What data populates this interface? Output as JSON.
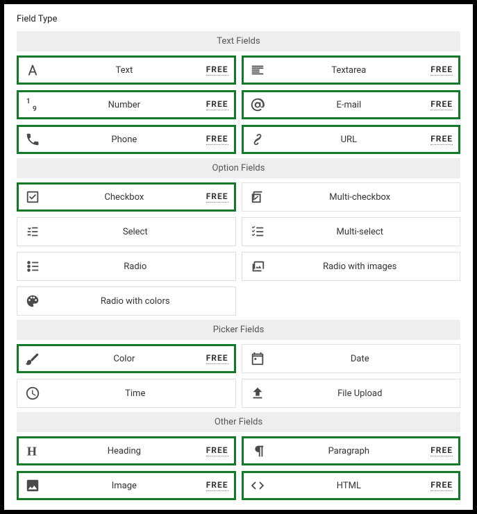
{
  "title": "Field Type",
  "free_label": "FREE",
  "sections": [
    {
      "id": "text-fields",
      "header": "Text Fields",
      "items": [
        {
          "id": "text",
          "label": "Text",
          "icon": "font-icon",
          "selected": true,
          "free": true
        },
        {
          "id": "textarea",
          "label": "Textarea",
          "icon": "align-left-icon",
          "selected": true,
          "free": true
        },
        {
          "id": "number",
          "label": "Number",
          "icon": "number-icon",
          "selected": true,
          "free": true
        },
        {
          "id": "email",
          "label": "E-mail",
          "icon": "at-icon",
          "selected": true,
          "free": true
        },
        {
          "id": "phone",
          "label": "Phone",
          "icon": "phone-icon",
          "selected": true,
          "free": true
        },
        {
          "id": "url",
          "label": "URL",
          "icon": "link-icon",
          "selected": true,
          "free": true
        }
      ]
    },
    {
      "id": "option-fields",
      "header": "Option Fields",
      "items": [
        {
          "id": "checkbox",
          "label": "Checkbox",
          "icon": "checkbox-icon",
          "selected": true,
          "free": true
        },
        {
          "id": "multi-checkbox",
          "label": "Multi-checkbox",
          "icon": "multi-checkbox-icon",
          "selected": false,
          "free": false
        },
        {
          "id": "select",
          "label": "Select",
          "icon": "select-icon",
          "selected": false,
          "free": false
        },
        {
          "id": "multi-select",
          "label": "Multi-select",
          "icon": "multi-select-icon",
          "selected": false,
          "free": false
        },
        {
          "id": "radio",
          "label": "Radio",
          "icon": "radio-icon",
          "selected": false,
          "free": false
        },
        {
          "id": "radio-images",
          "label": "Radio with images",
          "icon": "image-group-icon",
          "selected": false,
          "free": false
        },
        {
          "id": "radio-colors",
          "label": "Radio with colors",
          "icon": "palette-icon",
          "selected": false,
          "free": false
        }
      ]
    },
    {
      "id": "picker-fields",
      "header": "Picker Fields",
      "items": [
        {
          "id": "color",
          "label": "Color",
          "icon": "brush-icon",
          "selected": true,
          "free": true
        },
        {
          "id": "date",
          "label": "Date",
          "icon": "calendar-icon",
          "selected": false,
          "free": false
        },
        {
          "id": "time",
          "label": "Time",
          "icon": "clock-icon",
          "selected": false,
          "free": false
        },
        {
          "id": "file-upload",
          "label": "File Upload",
          "icon": "upload-icon",
          "selected": false,
          "free": false
        }
      ]
    },
    {
      "id": "other-fields",
      "header": "Other Fields",
      "items": [
        {
          "id": "heading",
          "label": "Heading",
          "icon": "heading-icon",
          "selected": true,
          "free": true
        },
        {
          "id": "paragraph",
          "label": "Paragraph",
          "icon": "paragraph-icon",
          "selected": true,
          "free": true
        },
        {
          "id": "image",
          "label": "Image",
          "icon": "image-icon",
          "selected": true,
          "free": true
        },
        {
          "id": "html",
          "label": "HTML",
          "icon": "code-icon",
          "selected": true,
          "free": true
        }
      ]
    }
  ]
}
